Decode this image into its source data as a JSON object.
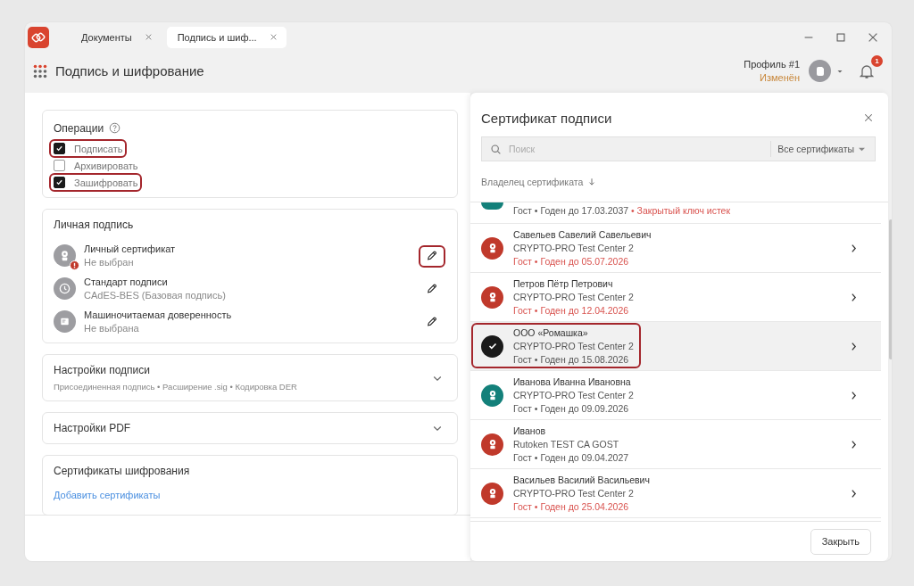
{
  "tabs": [
    {
      "label": "Документы",
      "selected": false
    },
    {
      "label": "Подпись и шиф...",
      "selected": true
    }
  ],
  "header": {
    "title": "Подпись и шифрование",
    "profile": {
      "name": "Профиль #1",
      "status": "Изменён"
    },
    "notifications": {
      "count": "1"
    }
  },
  "operations": {
    "title": "Операции",
    "options": [
      {
        "label": "Подписать",
        "checked": true,
        "highlighted": true
      },
      {
        "label": "Архивировать",
        "checked": false,
        "highlighted": false
      },
      {
        "label": "Зашифровать",
        "checked": true,
        "highlighted": true
      }
    ]
  },
  "personal_signature": {
    "title": "Личная подпись",
    "items": [
      {
        "kind": "certificate",
        "title": "Личный сертификат",
        "value": "Не выбран",
        "error": true,
        "highlighted": true
      },
      {
        "kind": "standard",
        "title": "Стандарт подписи",
        "value": "CAdES-BES (Базовая подпись)",
        "error": false,
        "highlighted": false
      },
      {
        "kind": "proxy",
        "title": "Машиночитаемая доверенность",
        "value": "Не выбрана",
        "error": false,
        "highlighted": false
      }
    ]
  },
  "signature_settings": {
    "title": "Настройки подписи",
    "summary": "Присоединенная подпись • Расширение .sig • Кодировка DER",
    "expanded": false
  },
  "pdf_settings": {
    "title": "Настройки PDF",
    "expanded": false
  },
  "encryption_certificates": {
    "title": "Сертификаты шифрования",
    "link": "Добавить сертификаты"
  },
  "drawer": {
    "title": "Сертификат подписи",
    "search": {
      "placeholder": "Поиск",
      "filter": "Все сертификаты"
    },
    "column": "Владелец сертификата",
    "certificates": [
      {
        "kind": "partial",
        "validity": "Гост • Годен до 17.03.2037",
        "note": "• Закрытый ключ истек",
        "expiring": false,
        "color": "#13807a",
        "selected": false,
        "highlighted": false
      },
      {
        "kind": "full",
        "name": "Савельев Савелий Савельевич",
        "issuer": "CRYPTO-PRO Test Center 2",
        "validity": "Гост • Годен до 05.07.2026",
        "expiring": true,
        "color": "#c0392b",
        "selected": false,
        "highlighted": false
      },
      {
        "kind": "full",
        "name": "Петров Пётр Петрович",
        "issuer": "CRYPTO-PRO Test Center 2",
        "validity": "Гост • Годен до 12.04.2026",
        "expiring": true,
        "color": "#c0392b",
        "selected": false,
        "highlighted": false
      },
      {
        "kind": "full",
        "name": "ООО «Ромашка»",
        "issuer": "CRYPTO-PRO Test Center 2",
        "validity": "Гост • Годен до 15.08.2026",
        "expiring": false,
        "selected": true,
        "highlighted": true
      },
      {
        "kind": "full",
        "name": "Иванова Иванна Ивановна",
        "issuer": "CRYPTO-PRO Test Center 2",
        "validity": "Гост • Годен до 09.09.2026",
        "expiring": false,
        "color": "#13807a",
        "selected": false,
        "highlighted": false
      },
      {
        "kind": "full",
        "name": "Иванов",
        "issuer": "Rutoken TEST CA GOST",
        "validity": "Гост • Годен до 09.04.2027",
        "expiring": false,
        "color": "#c0392b",
        "selected": false,
        "highlighted": false
      },
      {
        "kind": "full",
        "name": "Васильев Василий Васильевич",
        "issuer": "CRYPTO-PRO Test Center 2",
        "validity": "Гост • Годен до 25.04.2026",
        "expiring": true,
        "color": "#c0392b",
        "selected": false,
        "highlighted": false
      }
    ],
    "close_button": "Закрыть"
  }
}
